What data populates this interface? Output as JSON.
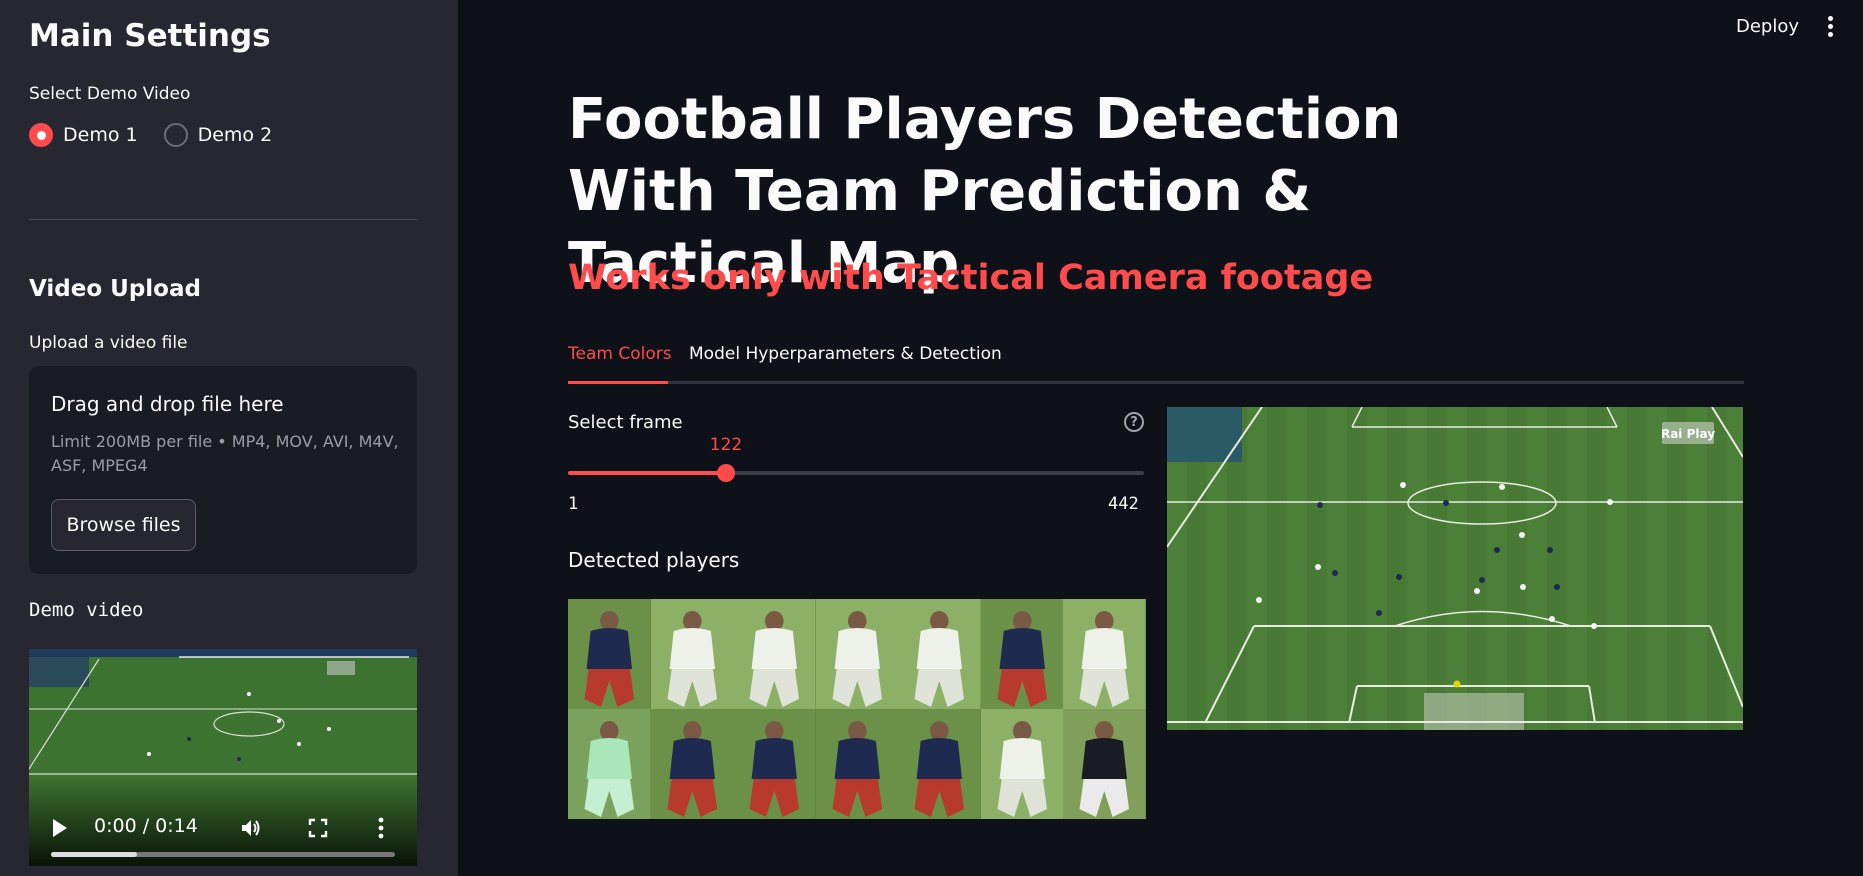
{
  "sidebar": {
    "title": "Main Settings",
    "demo_select_label": "Select Demo Video",
    "demo_options": [
      "Demo 1",
      "Demo 2"
    ],
    "demo_selected": "Demo 1",
    "upload_section_title": "Video Upload",
    "upload_label": "Upload a video file",
    "dropzone_title": "Drag and drop file here",
    "dropzone_limit": "Limit 200MB per file • MP4, MOV, AVI, M4V, ASF, MPEG4",
    "browse_button": "Browse files",
    "demo_video_label": "Demo video",
    "video_time": "0:00 / 0:14",
    "video_progress": 0.25
  },
  "header": {
    "deploy": "Deploy"
  },
  "main": {
    "title": "Football Players Detection With Team Prediction & Tactical Map",
    "subtitle": "Works only with Tactical Camera footage",
    "tabs": [
      {
        "label": "Team Colors",
        "active": true
      },
      {
        "label": "Model Hyperparameters & Detection",
        "active": false
      }
    ],
    "frame_label": "Select frame",
    "help_icon": "?",
    "slider": {
      "min": 1,
      "max": 442,
      "value": 122
    },
    "detected_label": "Detected players",
    "watermark": "Rai Play"
  },
  "colors": {
    "accent": "#ff4b4b",
    "background": "#0e1117",
    "sidebar": "#262730"
  }
}
